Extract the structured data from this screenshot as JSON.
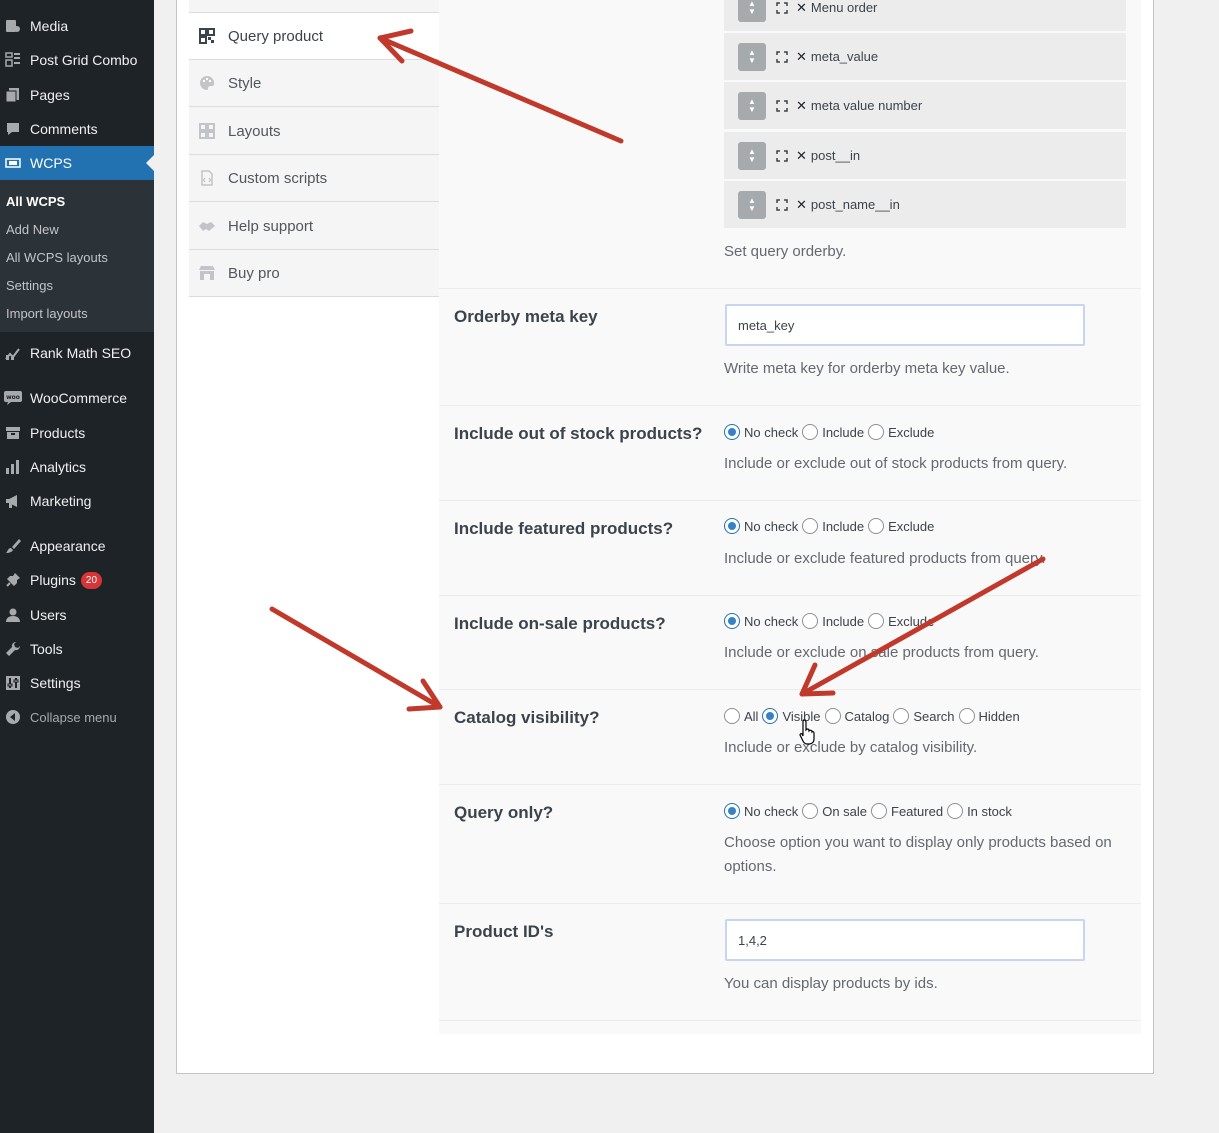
{
  "admin_menu": {
    "items": [
      {
        "label": "Media",
        "icon": "media-icon"
      },
      {
        "label": "Post Grid Combo",
        "icon": "grid-icon"
      },
      {
        "label": "Pages",
        "icon": "pages-icon"
      },
      {
        "label": "Comments",
        "icon": "comment-icon"
      },
      {
        "label": "WCPS",
        "icon": "slider-icon"
      },
      {
        "label": "Rank Math SEO",
        "icon": "chart-icon"
      },
      {
        "label": "WooCommerce",
        "icon": "woo-icon"
      },
      {
        "label": "Products",
        "icon": "archive-icon"
      },
      {
        "label": "Analytics",
        "icon": "bar-chart-icon"
      },
      {
        "label": "Marketing",
        "icon": "megaphone-icon"
      },
      {
        "label": "Appearance",
        "icon": "paintbrush-icon"
      },
      {
        "label": "Plugins",
        "icon": "plug-icon",
        "badge": "20"
      },
      {
        "label": "Users",
        "icon": "user-icon"
      },
      {
        "label": "Tools",
        "icon": "wrench-icon"
      },
      {
        "label": "Settings",
        "icon": "settings-icon"
      }
    ],
    "collapse_label": "Collapse menu",
    "submenu": [
      "All WCPS",
      "Add New",
      "All WCPS layouts",
      "Settings",
      "Import layouts"
    ]
  },
  "tabs": [
    "Query product",
    "Style",
    "Layouts",
    "Custom scripts",
    "Help support",
    "Buy pro"
  ],
  "orderby": {
    "items": [
      "Menu order",
      "meta_value",
      "meta value number",
      "post__in",
      "post_name__in"
    ],
    "description": "Set query orderby."
  },
  "fields": {
    "meta_key": {
      "label": "Orderby meta key",
      "value": "meta_key",
      "description": "Write meta key for orderby meta key value."
    },
    "out_of_stock": {
      "label": "Include out of stock products?",
      "options": [
        "No check",
        "Include",
        "Exclude"
      ],
      "description": "Include or exclude out of stock products from query."
    },
    "featured": {
      "label": "Include featured products?",
      "options": [
        "No check",
        "Include",
        "Exclude"
      ],
      "description": "Include or exclude featured products from query."
    },
    "on_sale": {
      "label": "Include on-sale products?",
      "options": [
        "No check",
        "Include",
        "Exclude"
      ],
      "description": "Include or exclude on sale products from query."
    },
    "catalog_visibility": {
      "label": "Catalog visibility?",
      "options": [
        "All",
        "Visible",
        "Catalog",
        "Search",
        "Hidden"
      ],
      "description": "Include or exclude by catalog visibility."
    },
    "query_only": {
      "label": "Query only?",
      "options": [
        "No check",
        "On sale",
        "Featured",
        "In stock"
      ],
      "description": "Choose option you want to display only products based on options."
    },
    "product_ids": {
      "label": "Product ID's",
      "value": "1,4,2",
      "description": "You can display products by ids."
    }
  },
  "colors": {
    "sidebar": "#1d2327",
    "accent": "#2271b1",
    "arrow": "#c0392b",
    "badge": "#d63638"
  }
}
